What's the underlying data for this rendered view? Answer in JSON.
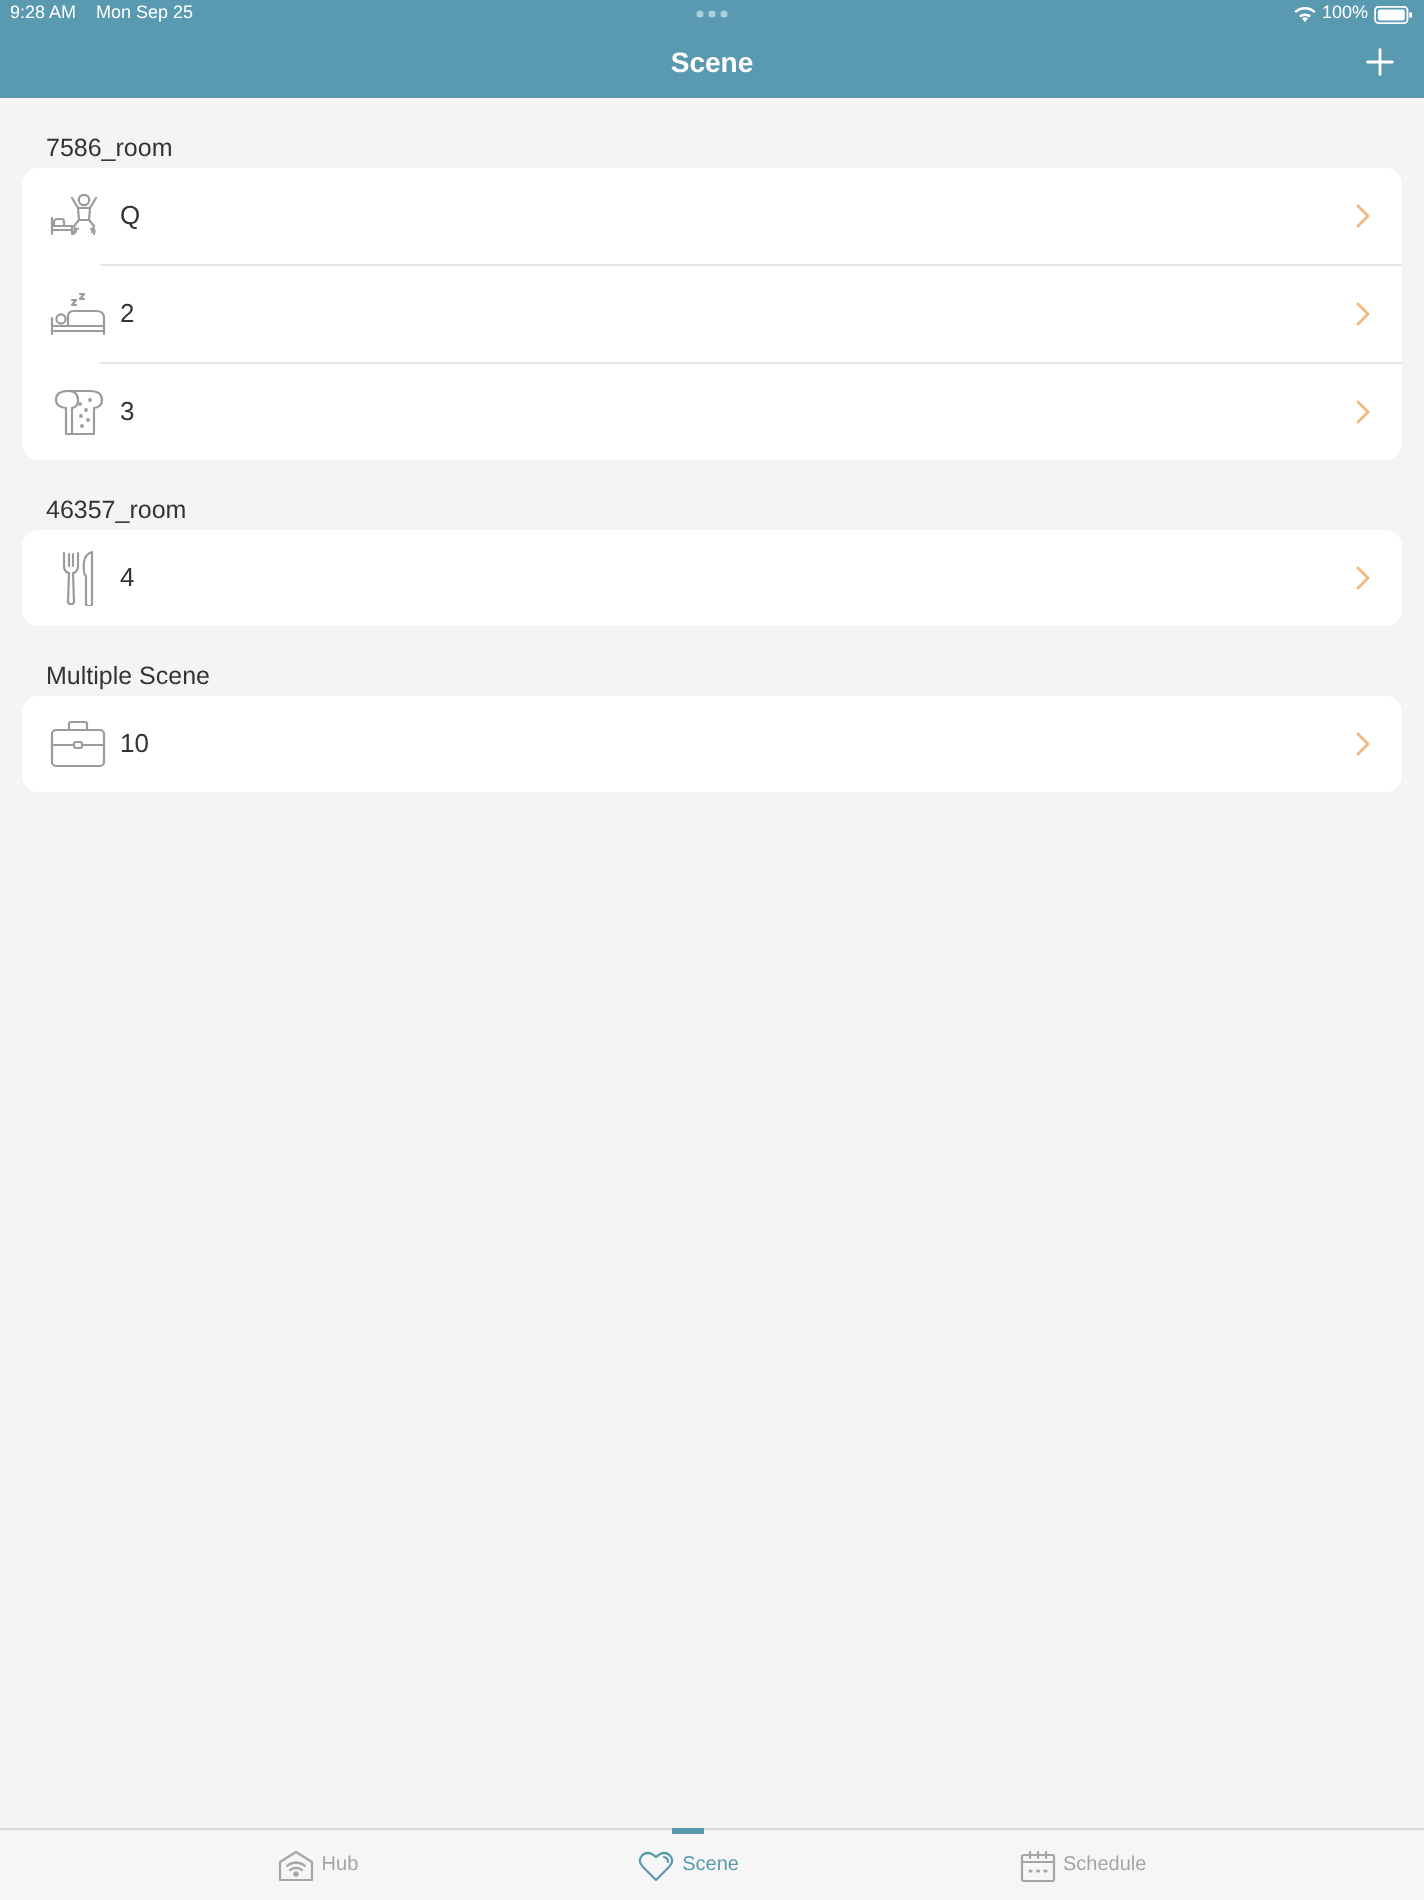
{
  "status_bar": {
    "time": "9:28 AM",
    "date": "Mon Sep 25",
    "battery": "100%"
  },
  "nav_bar": {
    "title": "Scene"
  },
  "sections": [
    {
      "title": "7586_room",
      "scenes": [
        {
          "name": "Q"
        },
        {
          "name": "2"
        },
        {
          "name": "3"
        }
      ]
    },
    {
      "title": "46357_room",
      "scenes": [
        {
          "name": "4"
        }
      ]
    },
    {
      "title": "Multiple Scene",
      "scenes": [
        {
          "name": "10"
        }
      ]
    }
  ],
  "tab_bar": {
    "tabs": [
      {
        "label": "Hub",
        "selected": false
      },
      {
        "label": "Scene",
        "selected": true
      },
      {
        "label": "Schedule",
        "selected": false
      }
    ]
  }
}
